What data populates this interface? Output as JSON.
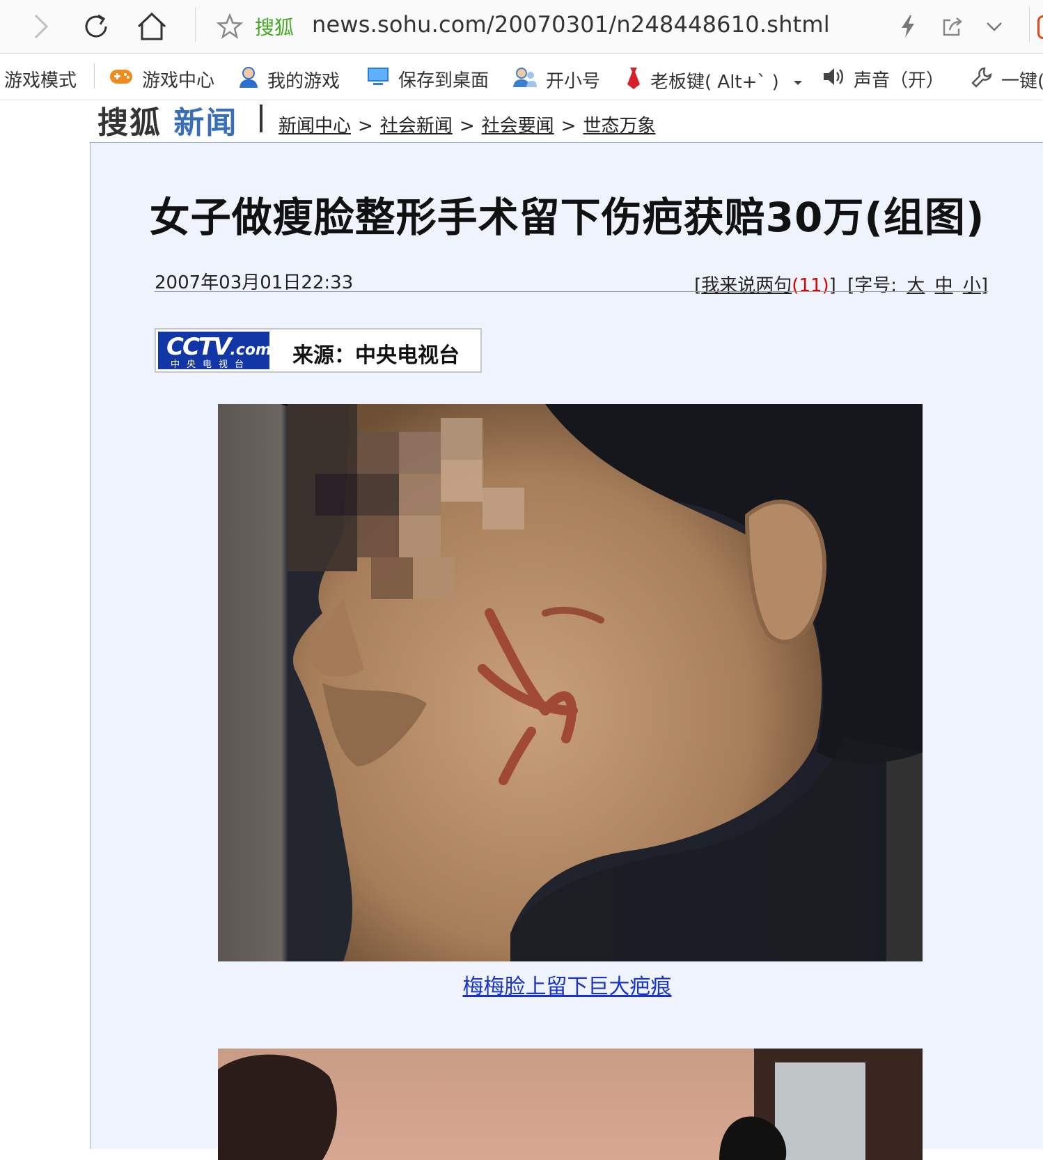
{
  "browser": {
    "site_name": "搜狐",
    "url": "news.sohu.com/20070301/n248448610.shtml"
  },
  "favorites": {
    "game_mode": "游戏模式",
    "items": [
      "游戏中心",
      "我的游戏",
      "保存到桌面",
      "开小号",
      "老板键( Alt+` )",
      "声音（开）",
      "一键("
    ]
  },
  "header": {
    "brand_sohu": "搜狐",
    "brand_news": "新闻",
    "breadcrumb": [
      "新闻中心",
      "社会新闻",
      "社会要闻",
      "世态万象"
    ],
    "separator": ">"
  },
  "article": {
    "title": "女子做瘦脸整形手术留下伤疤获赔30万(组图)",
    "datetime": "2007年03月01日22:33",
    "comment_prefix": "[",
    "comment_link": "我来说两句",
    "comment_count": "(11)",
    "comment_suffix": "]",
    "fontsize_label": "[字号:",
    "font_large": "大",
    "font_medium": "中",
    "font_small": "小",
    "fontsize_close": "]",
    "source_label": "来源：中央电视台",
    "logo_text": "CCTV",
    "logo_domain": ".com",
    "logo_sub": "中央电视台",
    "photo_caption": "梅梅脸上留下巨大疤痕"
  }
}
